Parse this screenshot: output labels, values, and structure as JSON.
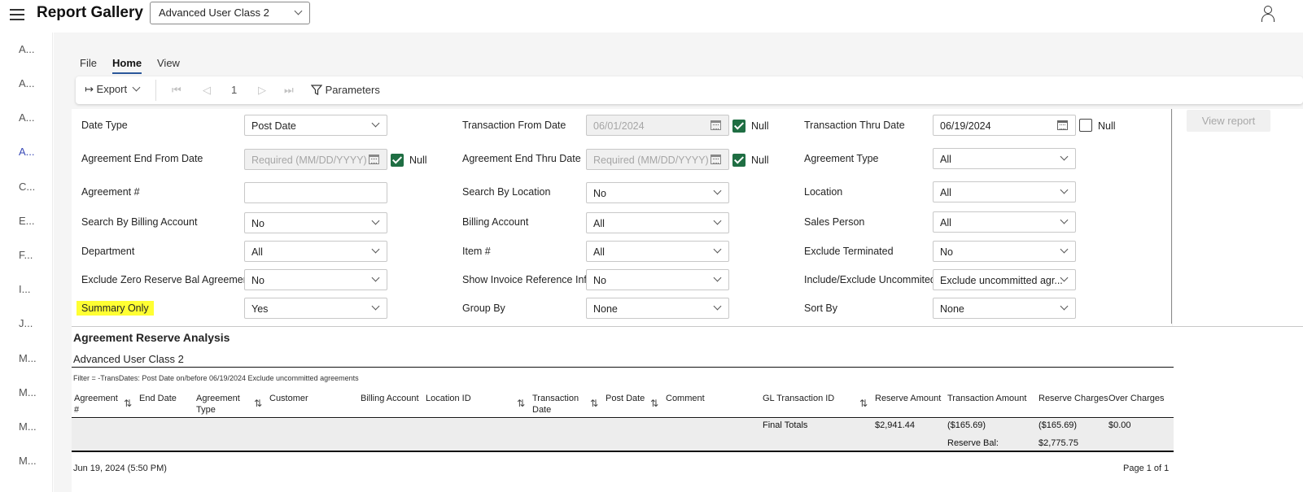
{
  "header": {
    "title": "Report Gallery",
    "class_select": "Advanced User Class 2"
  },
  "leftnav": [
    "A...",
    "A...",
    "A...",
    "A...",
    "C...",
    "E...",
    "F...",
    "I...",
    "J...",
    "M...",
    "M...",
    "M...",
    "M..."
  ],
  "ribbon": {
    "tabs": [
      "File",
      "Home",
      "View"
    ],
    "active": "Home"
  },
  "toolbar": {
    "export": "Export",
    "page": "1",
    "parameters": "Parameters"
  },
  "view_report": "View report",
  "null_label": "Null",
  "params": {
    "date_type": {
      "label": "Date Type",
      "value": "Post Date"
    },
    "trans_from": {
      "label": "Transaction From Date",
      "value": "06/01/2024"
    },
    "trans_thru": {
      "label": "Transaction Thru Date",
      "value": "06/19/2024"
    },
    "agr_end_from": {
      "label": "Agreement End From Date",
      "placeholder": "Required (MM/DD/YYYY)"
    },
    "agr_end_thru": {
      "label": "Agreement End Thru Date",
      "placeholder": "Required (MM/DD/YYYY)"
    },
    "agr_type": {
      "label": "Agreement Type",
      "value": "All"
    },
    "agr_num": {
      "label": "Agreement #",
      "value": ""
    },
    "search_loc": {
      "label": "Search By Location",
      "value": "No"
    },
    "location": {
      "label": "Location",
      "value": "All"
    },
    "search_bill": {
      "label": "Search By Billing Account",
      "value": "No"
    },
    "billing": {
      "label": "Billing Account",
      "value": "All"
    },
    "sales": {
      "label": "Sales Person",
      "value": "All"
    },
    "dept": {
      "label": "Department",
      "value": "All"
    },
    "item": {
      "label": "Item #",
      "value": "All"
    },
    "excl_term": {
      "label": "Exclude Terminated",
      "value": "No"
    },
    "excl_zero": {
      "label": "Exclude Zero Reserve Bal Agreements",
      "value": "No"
    },
    "show_inv": {
      "label": "Show Invoice Reference Info",
      "value": "No"
    },
    "incl_excl": {
      "label": "Include/Exclude Uncommited",
      "value": "Exclude uncommitted agr..."
    },
    "summary": {
      "label": "Summary Only",
      "value": "Yes"
    },
    "group_by": {
      "label": "Group By",
      "value": "None"
    },
    "sort_by": {
      "label": "Sort By",
      "value": "None"
    }
  },
  "report": {
    "title": "Agreement Reserve Analysis",
    "subtitle": "Advanced User Class 2",
    "filter": "Filter = -TransDates: Post Date on/before 06/19/2024 Exclude uncommitted agreements",
    "columns": {
      "agreement": "Agreement #",
      "end_date": "End Date",
      "agr_type": "Agreement Type",
      "customer": "Customer",
      "billing": "Billing Account",
      "location_id": "Location ID",
      "trans_date": "Transaction Date",
      "post_date": "Post Date",
      "comment": "Comment",
      "gl_id": "GL Transaction ID",
      "reserve_amt": "Reserve Amount",
      "trans_amt": "Transaction Amount",
      "reserve_chg": "Reserve Charges",
      "over_chg": "Over Charges"
    },
    "totals": {
      "label": "Final Totals",
      "reserve_amount": "$2,941.44",
      "transaction_amount": "($165.69)",
      "reserve_charges": "($165.69)",
      "over_charges": "$0.00",
      "bal_label": "Reserve Bal:",
      "bal_value": "$2,775.75"
    },
    "footer_date": "Jun 19, 2024 (5:50 PM)",
    "footer_page": "Page 1 of 1"
  }
}
